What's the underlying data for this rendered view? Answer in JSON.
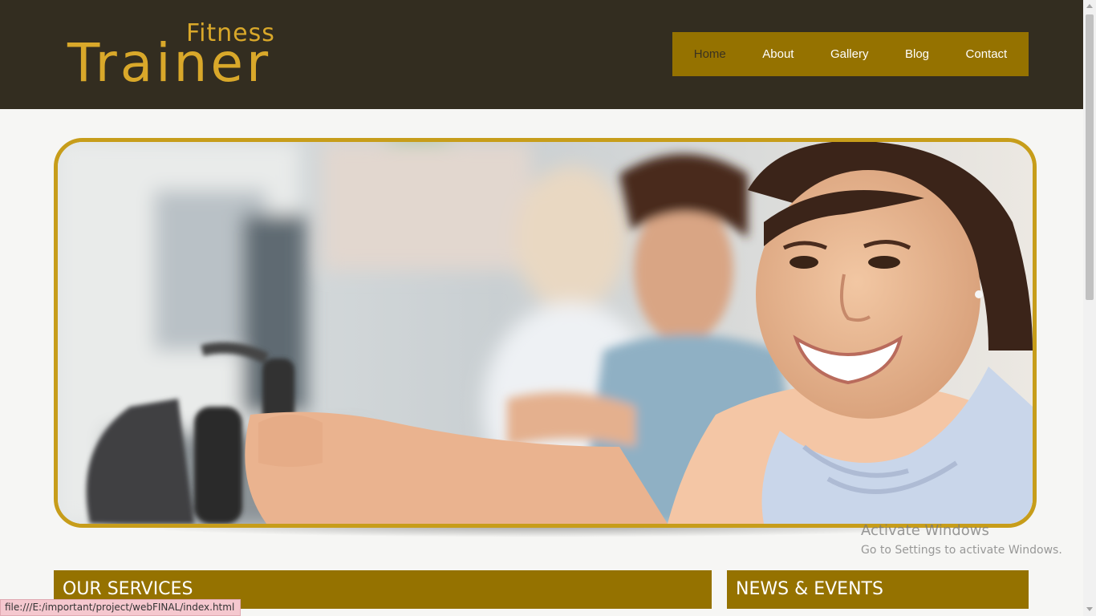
{
  "logo": {
    "small_text": "Fitness",
    "big_text": "Trainer",
    "color": "#d9a82a"
  },
  "nav": {
    "items": [
      {
        "label": "Home",
        "active": true
      },
      {
        "label": "About",
        "active": false
      },
      {
        "label": "Gallery",
        "active": false
      },
      {
        "label": "Blog",
        "active": false
      },
      {
        "label": "Contact",
        "active": false
      }
    ],
    "background": "#957200"
  },
  "hero": {
    "border_color": "#c79d1a"
  },
  "sections": {
    "services_title": "OUR SERVICES",
    "news_title": "NEWS & EVENTS"
  },
  "watermark": {
    "title": "Activate Windows",
    "subtitle": "Go to Settings to activate Windows."
  },
  "statusbar": {
    "url": "file:///E:/important/project/webFINAL/index.html"
  },
  "colors": {
    "header_bg": "#332d20",
    "accent": "#957200"
  }
}
